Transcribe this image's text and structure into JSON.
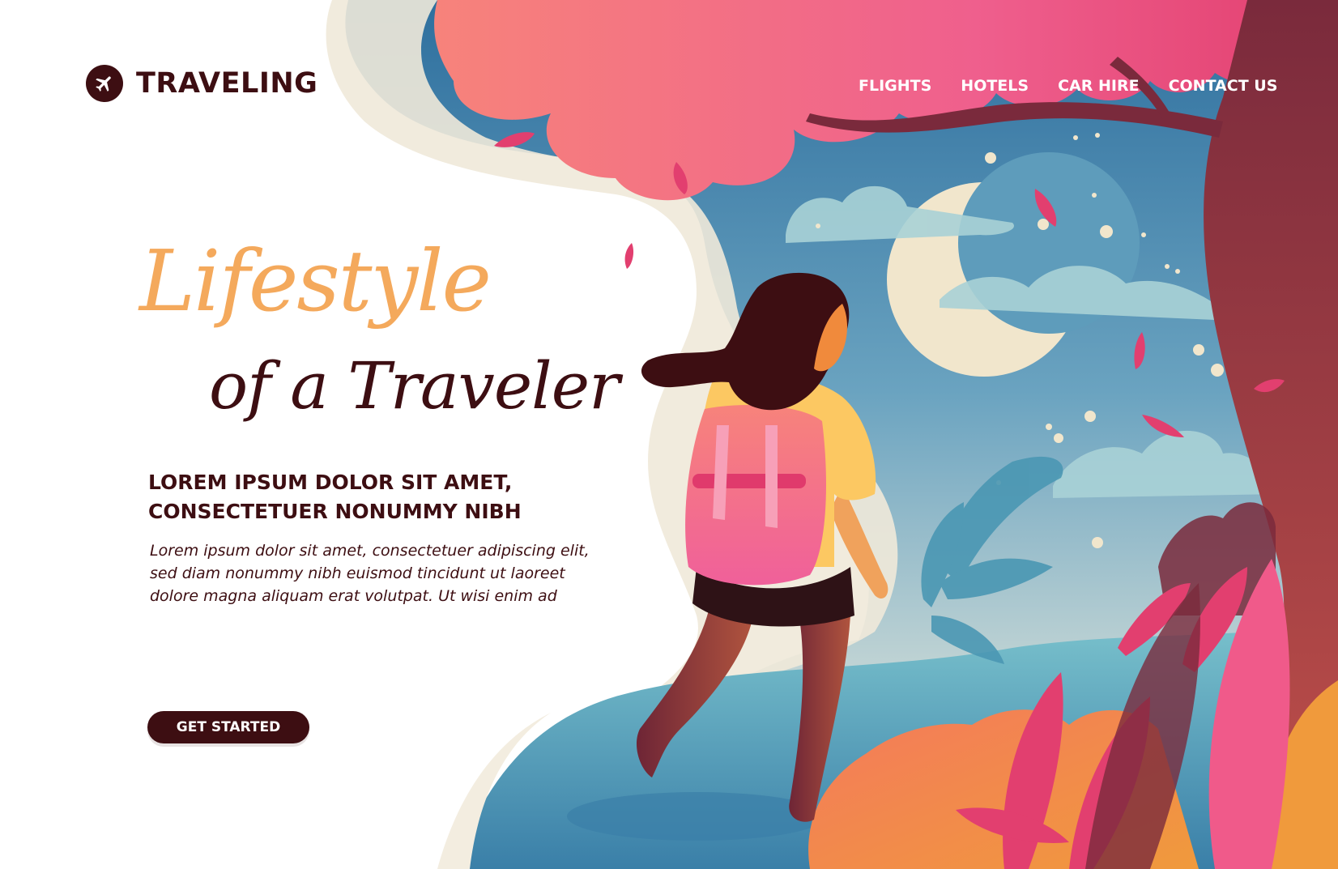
{
  "header": {
    "logo_text": "TRAVELING",
    "nav": [
      "FLIGHTS",
      "HOTELS",
      "CAR HIRE",
      "CONTACT US"
    ]
  },
  "hero": {
    "script_line1": "Lifestyle",
    "script_line2": "of a Traveler",
    "subheading": "LOREM IPSUM DOLOR SIT AMET, CONSECTETUER NONUMMY NIBH",
    "body": "Lorem ipsum dolor sit amet, consectetuer adipiscing elit, sed diam nonummy nibh euismod tincidunt ut laoreet dolore magna aliquam erat volutpat. Ut wisi enim ad",
    "cta_label": "GET STARTED"
  },
  "colors": {
    "dark": "#3d0e12",
    "accent_orange": "#f4a95c",
    "pink": "#f06292",
    "sky_blue": "#3f86ae"
  },
  "icons": {
    "logo": "airplane-icon"
  }
}
